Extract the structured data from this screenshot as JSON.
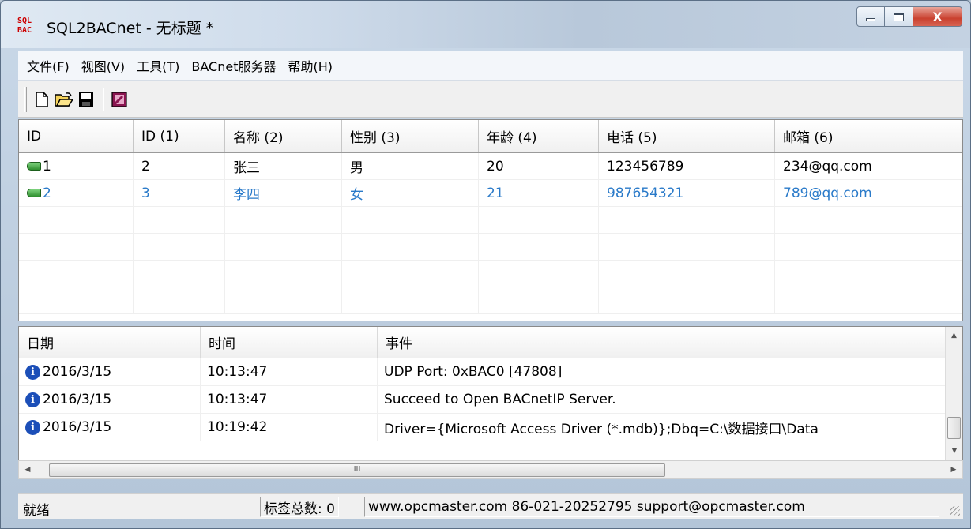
{
  "window": {
    "title": "SQL2BACnet - 无标题 *",
    "icon_top": "SQL",
    "icon_bottom": "BAC",
    "close_label": "X"
  },
  "menu": [
    "文件(F)",
    "视图(V)",
    "工具(T)",
    "BACnet服务器",
    "帮助(H)"
  ],
  "toolbar": [
    "new-file-icon",
    "open-folder-icon",
    "save-disk-icon",
    "edit-tags-icon"
  ],
  "grid": {
    "columns": [
      "ID",
      "ID (1)",
      "名称 (2)",
      "性别 (3)",
      "年龄 (4)",
      "电话 (5)",
      "邮箱 (6)"
    ],
    "rows": [
      [
        "1",
        "2",
        "张三",
        "男",
        "20",
        "123456789",
        "234@qq.com"
      ],
      [
        "2",
        "3",
        "李四",
        "女",
        "21",
        "987654321",
        "789@qq.com"
      ]
    ]
  },
  "log": {
    "columns": [
      "日期",
      "时间",
      "事件"
    ],
    "rows": [
      [
        "2016/3/15",
        "10:13:47",
        "UDP Port: 0xBAC0 [47808]"
      ],
      [
        "2016/3/15",
        "10:13:47",
        "Succeed to Open BACnetIP Server."
      ],
      [
        "2016/3/15",
        "10:19:42",
        "Driver={Microsoft Access Driver (*.mdb)};Dbq=C:\\数据接口\\Data"
      ]
    ]
  },
  "hscroll_thumb_mark": "III",
  "status": {
    "ready": "就绪",
    "tag_count": "标签总数: 0",
    "info": "www.opcmaster.com 86-021-20252795 support@opcmaster.com"
  },
  "colors": {
    "selected_text": "#2a7ac9",
    "tag_icon": "#2f8f2f",
    "info_icon": "#1c4fb8"
  }
}
